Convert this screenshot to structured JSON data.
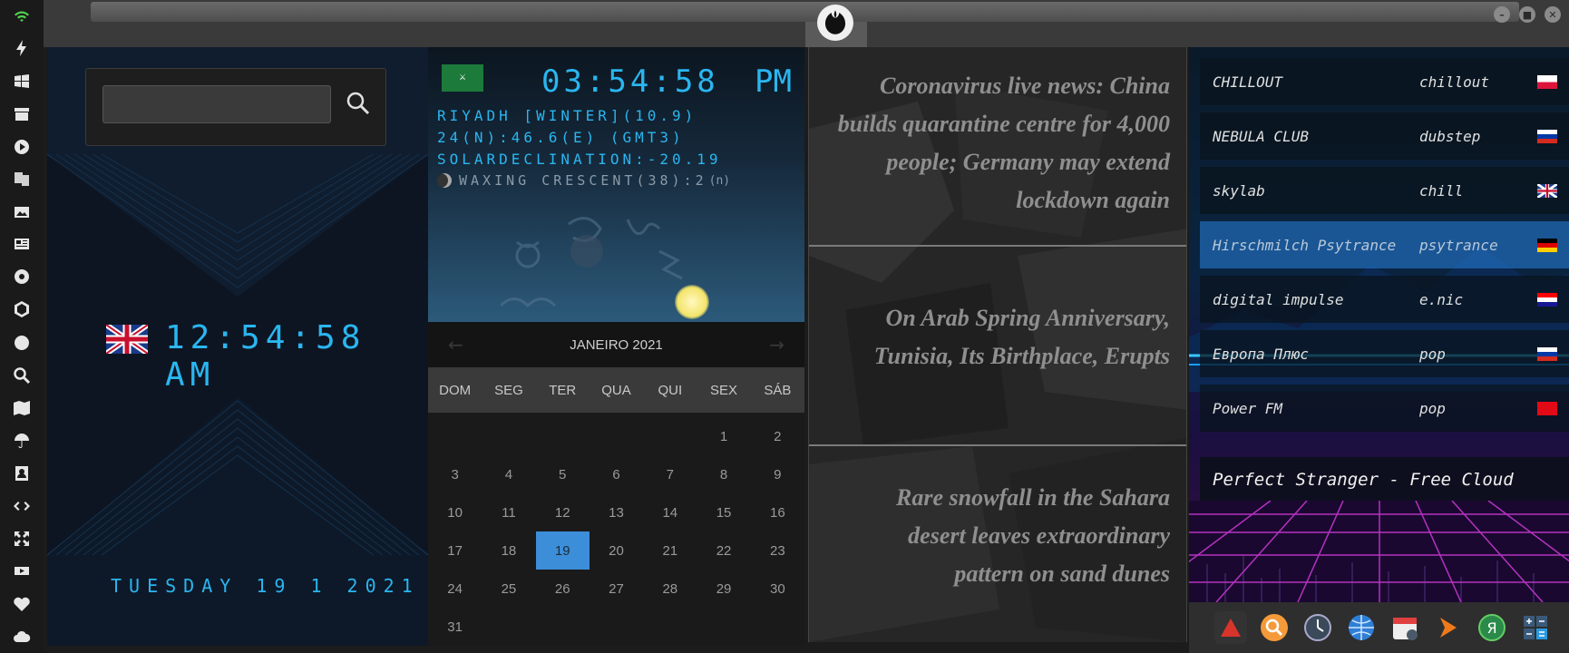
{
  "iconbar": {
    "icons": [
      "wifi-icon",
      "lightning-icon",
      "windows-icon",
      "archive-icon",
      "play-icon",
      "translate-icon",
      "image-icon",
      "news-icon",
      "settings-gear-icon",
      "hexagon-icon",
      "globe-icon",
      "search-icon",
      "map-icon",
      "umbrella-icon",
      "contacts-icon",
      "code-icon",
      "expand-icon",
      "youtube-icon",
      "heart-icon",
      "cloud-icon"
    ],
    "accent": "#4fd14f"
  },
  "window": {
    "logo": "rebel-alliance-icon",
    "buttons": [
      "minimize",
      "maximize",
      "close"
    ]
  },
  "clock_uk": {
    "search_placeholder": "",
    "search_icon": "search-icon",
    "time": "12:54:58 AM",
    "date": "TUESDAY 19 1 2021",
    "flag": "uk-flag",
    "color": "#2ab6f0"
  },
  "sky": {
    "flag": "saudi-flag",
    "time": "03:54:58",
    "ampm": "PM",
    "line1": "RIYADH [WINTER](10.9)",
    "line2": "24(N):46.6(E) (GMT3)",
    "line3": "SOLARDECLINATION:-20.19",
    "moon": "WAXING CRESCENT(38):2",
    "moon_suffix": "(n)"
  },
  "calendar": {
    "month": "JANEIRO 2021",
    "prev": "←",
    "next": "→",
    "weekdays": [
      "DOM",
      "SEG",
      "TER",
      "QUA",
      "QUI",
      "SEX",
      "SÁB"
    ],
    "days": [
      "",
      "",
      "",
      "",
      "",
      "1",
      "2",
      "3",
      "4",
      "5",
      "6",
      "7",
      "8",
      "9",
      "10",
      "11",
      "12",
      "13",
      "14",
      "15",
      "16",
      "17",
      "18",
      "19",
      "20",
      "21",
      "22",
      "23",
      "24",
      "25",
      "26",
      "27",
      "28",
      "29",
      "30",
      "31"
    ],
    "today": "19"
  },
  "news": {
    "items": [
      "Coronavirus live news: China builds quarantine centre for 4,000 people; Germany may extend lockdown again",
      "On Arab Spring Anniversary, Tunisia, Its Birthplace, Erupts",
      "Rare snowfall in the Sahara desert leaves extraordinary pattern on sand dunes"
    ]
  },
  "radio": {
    "stations": [
      {
        "name": "CHILLOUT",
        "genre": "chillout",
        "flag": "poland-flag"
      },
      {
        "name": "NEBULA CLUB",
        "genre": "dubstep",
        "flag": "russia-flag"
      },
      {
        "name": "skylab",
        "genre": "chill",
        "flag": "uk-flag"
      },
      {
        "name": "Hirschmilch Psytrance",
        "genre": "psytrance",
        "flag": "germany-flag"
      },
      {
        "name": "digital impulse",
        "genre": "e.nic",
        "flag": "croatia-flag"
      },
      {
        "name": "Европа Плюс",
        "genre": "pop",
        "flag": "russia-flag"
      },
      {
        "name": "Power FM",
        "genre": "pop",
        "flag": "turkey-flag"
      }
    ],
    "active_index": 3,
    "now_playing": "Perfect Stranger - Free Cloud"
  },
  "dock": {
    "apps": [
      "triangle-app-icon",
      "search-app-icon",
      "clock-app-icon",
      "globe-app-icon",
      "calendar-app-icon",
      "play-app-icon",
      "yandex-app-icon",
      "calculator-app-icon"
    ]
  }
}
